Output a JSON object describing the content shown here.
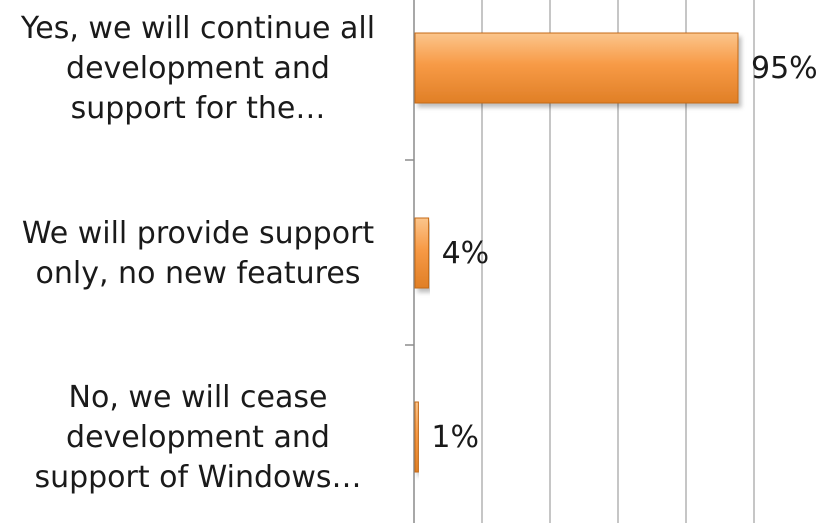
{
  "chart_data": {
    "type": "bar",
    "orientation": "horizontal",
    "categories": [
      [
        "Yes, we will continue all",
        "development and",
        "support for the…"
      ],
      [
        "We will provide support",
        "only, no new features"
      ],
      [
        "No, we will cease",
        "development and",
        "support of Windows…"
      ]
    ],
    "values": [
      95,
      4,
      1
    ],
    "data_labels": [
      "95%",
      "4%",
      "1%"
    ],
    "xlim": [
      0,
      100
    ],
    "grid": true,
    "legend": "none",
    "colors": {
      "bar_fill_top": "#fbc58c",
      "bar_fill_mid": "#f79a46",
      "bar_fill_bottom": "#e07f26",
      "bar_stroke": "#c56a18",
      "grid": "#8c8c8c",
      "axis": "#8c8c8c",
      "text": "#1a1a1a"
    }
  }
}
